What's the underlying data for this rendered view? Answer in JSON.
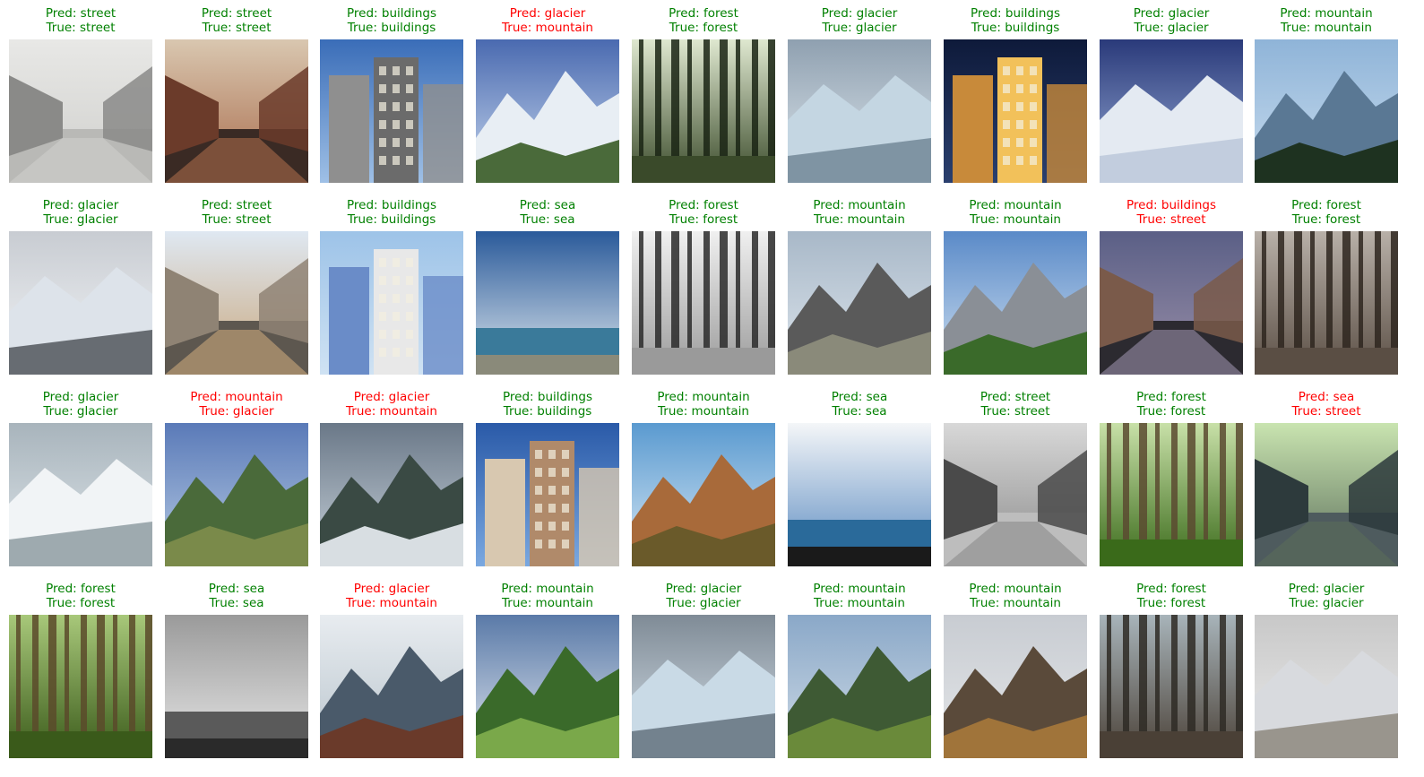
{
  "figure": {
    "colors": {
      "correct": "#008000",
      "incorrect": "#ff0000"
    },
    "cells": [
      {
        "pred": "Pred: street",
        "true": "True: street",
        "correct": true,
        "scene": "street",
        "variant": 0
      },
      {
        "pred": "Pred: street",
        "true": "True: street",
        "correct": true,
        "scene": "street",
        "variant": 1
      },
      {
        "pred": "Pred: buildings",
        "true": "True: buildings",
        "correct": true,
        "scene": "buildings",
        "variant": 0
      },
      {
        "pred": "Pred: glacier",
        "true": "True: mountain",
        "correct": false,
        "scene": "mountain",
        "variant": 0
      },
      {
        "pred": "Pred: forest",
        "true": "True: forest",
        "correct": true,
        "scene": "forest",
        "variant": 0
      },
      {
        "pred": "Pred: glacier",
        "true": "True: glacier",
        "correct": true,
        "scene": "glacier",
        "variant": 0
      },
      {
        "pred": "Pred: buildings",
        "true": "True: buildings",
        "correct": true,
        "scene": "buildings",
        "variant": 1
      },
      {
        "pred": "Pred: glacier",
        "true": "True: glacier",
        "correct": true,
        "scene": "glacier",
        "variant": 1
      },
      {
        "pred": "Pred: mountain",
        "true": "True: mountain",
        "correct": true,
        "scene": "mountain",
        "variant": 1
      },
      {
        "pred": "Pred: glacier",
        "true": "True: glacier",
        "correct": true,
        "scene": "glacier",
        "variant": 2
      },
      {
        "pred": "Pred: street",
        "true": "True: street",
        "correct": true,
        "scene": "street",
        "variant": 2
      },
      {
        "pred": "Pred: buildings",
        "true": "True: buildings",
        "correct": true,
        "scene": "buildings",
        "variant": 2
      },
      {
        "pred": "Pred: sea",
        "true": "True: sea",
        "correct": true,
        "scene": "sea",
        "variant": 0
      },
      {
        "pred": "Pred: forest",
        "true": "True: forest",
        "correct": true,
        "scene": "forest",
        "variant": 1
      },
      {
        "pred": "Pred: mountain",
        "true": "True: mountain",
        "correct": true,
        "scene": "mountain",
        "variant": 2
      },
      {
        "pred": "Pred: mountain",
        "true": "True: mountain",
        "correct": true,
        "scene": "mountain",
        "variant": 3
      },
      {
        "pred": "Pred: buildings",
        "true": "True: street",
        "correct": false,
        "scene": "street",
        "variant": 3
      },
      {
        "pred": "Pred: forest",
        "true": "True: forest",
        "correct": true,
        "scene": "forest",
        "variant": 2
      },
      {
        "pred": "Pred: glacier",
        "true": "True: glacier",
        "correct": true,
        "scene": "glacier",
        "variant": 3
      },
      {
        "pred": "Pred: mountain",
        "true": "True: glacier",
        "correct": false,
        "scene": "mountain",
        "variant": 4
      },
      {
        "pred": "Pred: glacier",
        "true": "True: mountain",
        "correct": false,
        "scene": "mountain",
        "variant": 5
      },
      {
        "pred": "Pred: buildings",
        "true": "True: buildings",
        "correct": true,
        "scene": "buildings",
        "variant": 3
      },
      {
        "pred": "Pred: mountain",
        "true": "True: mountain",
        "correct": true,
        "scene": "mountain",
        "variant": 6
      },
      {
        "pred": "Pred: sea",
        "true": "True: sea",
        "correct": true,
        "scene": "sea",
        "variant": 1
      },
      {
        "pred": "Pred: street",
        "true": "True: street",
        "correct": true,
        "scene": "street",
        "variant": 4
      },
      {
        "pred": "Pred: forest",
        "true": "True: forest",
        "correct": true,
        "scene": "forest",
        "variant": 3
      },
      {
        "pred": "Pred: sea",
        "true": "True: street",
        "correct": false,
        "scene": "street",
        "variant": 5
      },
      {
        "pred": "Pred: forest",
        "true": "True: forest",
        "correct": true,
        "scene": "forest",
        "variant": 4
      },
      {
        "pred": "Pred: sea",
        "true": "True: sea",
        "correct": true,
        "scene": "sea",
        "variant": 2
      },
      {
        "pred": "Pred: glacier",
        "true": "True: mountain",
        "correct": false,
        "scene": "mountain",
        "variant": 7
      },
      {
        "pred": "Pred: mountain",
        "true": "True: mountain",
        "correct": true,
        "scene": "mountain",
        "variant": 8
      },
      {
        "pred": "Pred: glacier",
        "true": "True: glacier",
        "correct": true,
        "scene": "glacier",
        "variant": 4
      },
      {
        "pred": "Pred: mountain",
        "true": "True: mountain",
        "correct": true,
        "scene": "mountain",
        "variant": 9
      },
      {
        "pred": "Pred: mountain",
        "true": "True: mountain",
        "correct": true,
        "scene": "mountain",
        "variant": 10
      },
      {
        "pred": "Pred: forest",
        "true": "True: forest",
        "correct": true,
        "scene": "forest",
        "variant": 5
      },
      {
        "pred": "Pred: glacier",
        "true": "True: glacier",
        "correct": true,
        "scene": "glacier",
        "variant": 5
      }
    ]
  }
}
